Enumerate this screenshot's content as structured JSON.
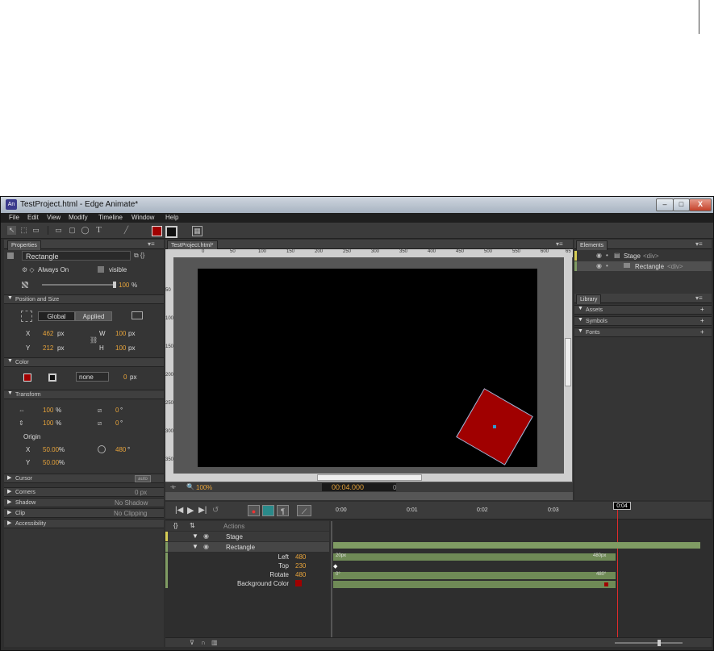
{
  "window": {
    "title": "TestProject.html - Edge Animate*",
    "app_icon": "An",
    "min": "–",
    "max": "□",
    "close": "X"
  },
  "menu": [
    "File",
    "Edit",
    "View",
    "Modify",
    "Timeline",
    "Window",
    "Help"
  ],
  "colors": {
    "fill": "#a00000",
    "stage": "#000000",
    "accent_orange": "#e6a33b",
    "track_green": "#7f9b63",
    "playhead": "#e02b2b"
  },
  "properties": {
    "tab": "Properties",
    "element_name": "Rectangle",
    "always_on": "Always On",
    "visible": "visible",
    "opacity": "100",
    "opacity_unit": "%",
    "sections": {
      "position": "Position and Size",
      "color": "Color",
      "transform": "Transform",
      "cursor": "Cursor",
      "corners": "Corners",
      "shadow": "Shadow",
      "clip": "Clip",
      "accessibility": "Accessibility"
    },
    "global": "Global",
    "applied": "Applied",
    "x": "462",
    "y": "212",
    "w": "100",
    "h": "100",
    "px": "px",
    "labels": {
      "x": "X",
      "y": "Y",
      "w": "W",
      "h": "H",
      "origin": "Origin"
    },
    "border_style": "none",
    "border_width": "0",
    "border_unit": "px",
    "scale_x": "100",
    "scale_y": "100",
    "pct": "%",
    "skew_x": "0",
    "skew_y": "0",
    "deg": "°",
    "origin_x": "50.00",
    "origin_y": "50.00",
    "rotate": "480",
    "cursor_btn": "auto",
    "corners_val": "0 px",
    "shadow_val": "No Shadow",
    "clip_val": "No Clipping"
  },
  "stage": {
    "tab": "TestProject.html*",
    "zoom": "100",
    "zoom_unit": "%",
    "time": "00:04.000",
    "time2": "0",
    "ruler": [
      "0",
      "50",
      "100",
      "150",
      "200",
      "250",
      "300",
      "350",
      "400",
      "450",
      "500",
      "550",
      "600",
      "65"
    ],
    "vruler": [
      "50",
      "100",
      "150",
      "200",
      "250",
      "300",
      "350"
    ]
  },
  "elements": {
    "tab": "Elements",
    "stage_name": "Stage",
    "stage_tag": "<div>",
    "rect_name": "Rectangle",
    "rect_tag": "<div>"
  },
  "library": {
    "tab": "Library",
    "items": [
      "Assets",
      "Symbols",
      "Fonts"
    ]
  },
  "timeline": {
    "ticks": [
      "0:00",
      "0:01",
      "0:02",
      "0:03"
    ],
    "playhead": "0:04",
    "actions": "Actions",
    "stage": "Stage",
    "rectangle": "Rectangle",
    "props": [
      {
        "name": "Left",
        "value": "480",
        "start": "20px",
        "end": "480px"
      },
      {
        "name": "Top",
        "value": "230",
        "start": "",
        "end": ""
      },
      {
        "name": "Rotate",
        "value": "480",
        "start": "0°",
        "end": "480°"
      },
      {
        "name": "Background Color",
        "value": "",
        "start": "",
        "end": ""
      }
    ]
  }
}
